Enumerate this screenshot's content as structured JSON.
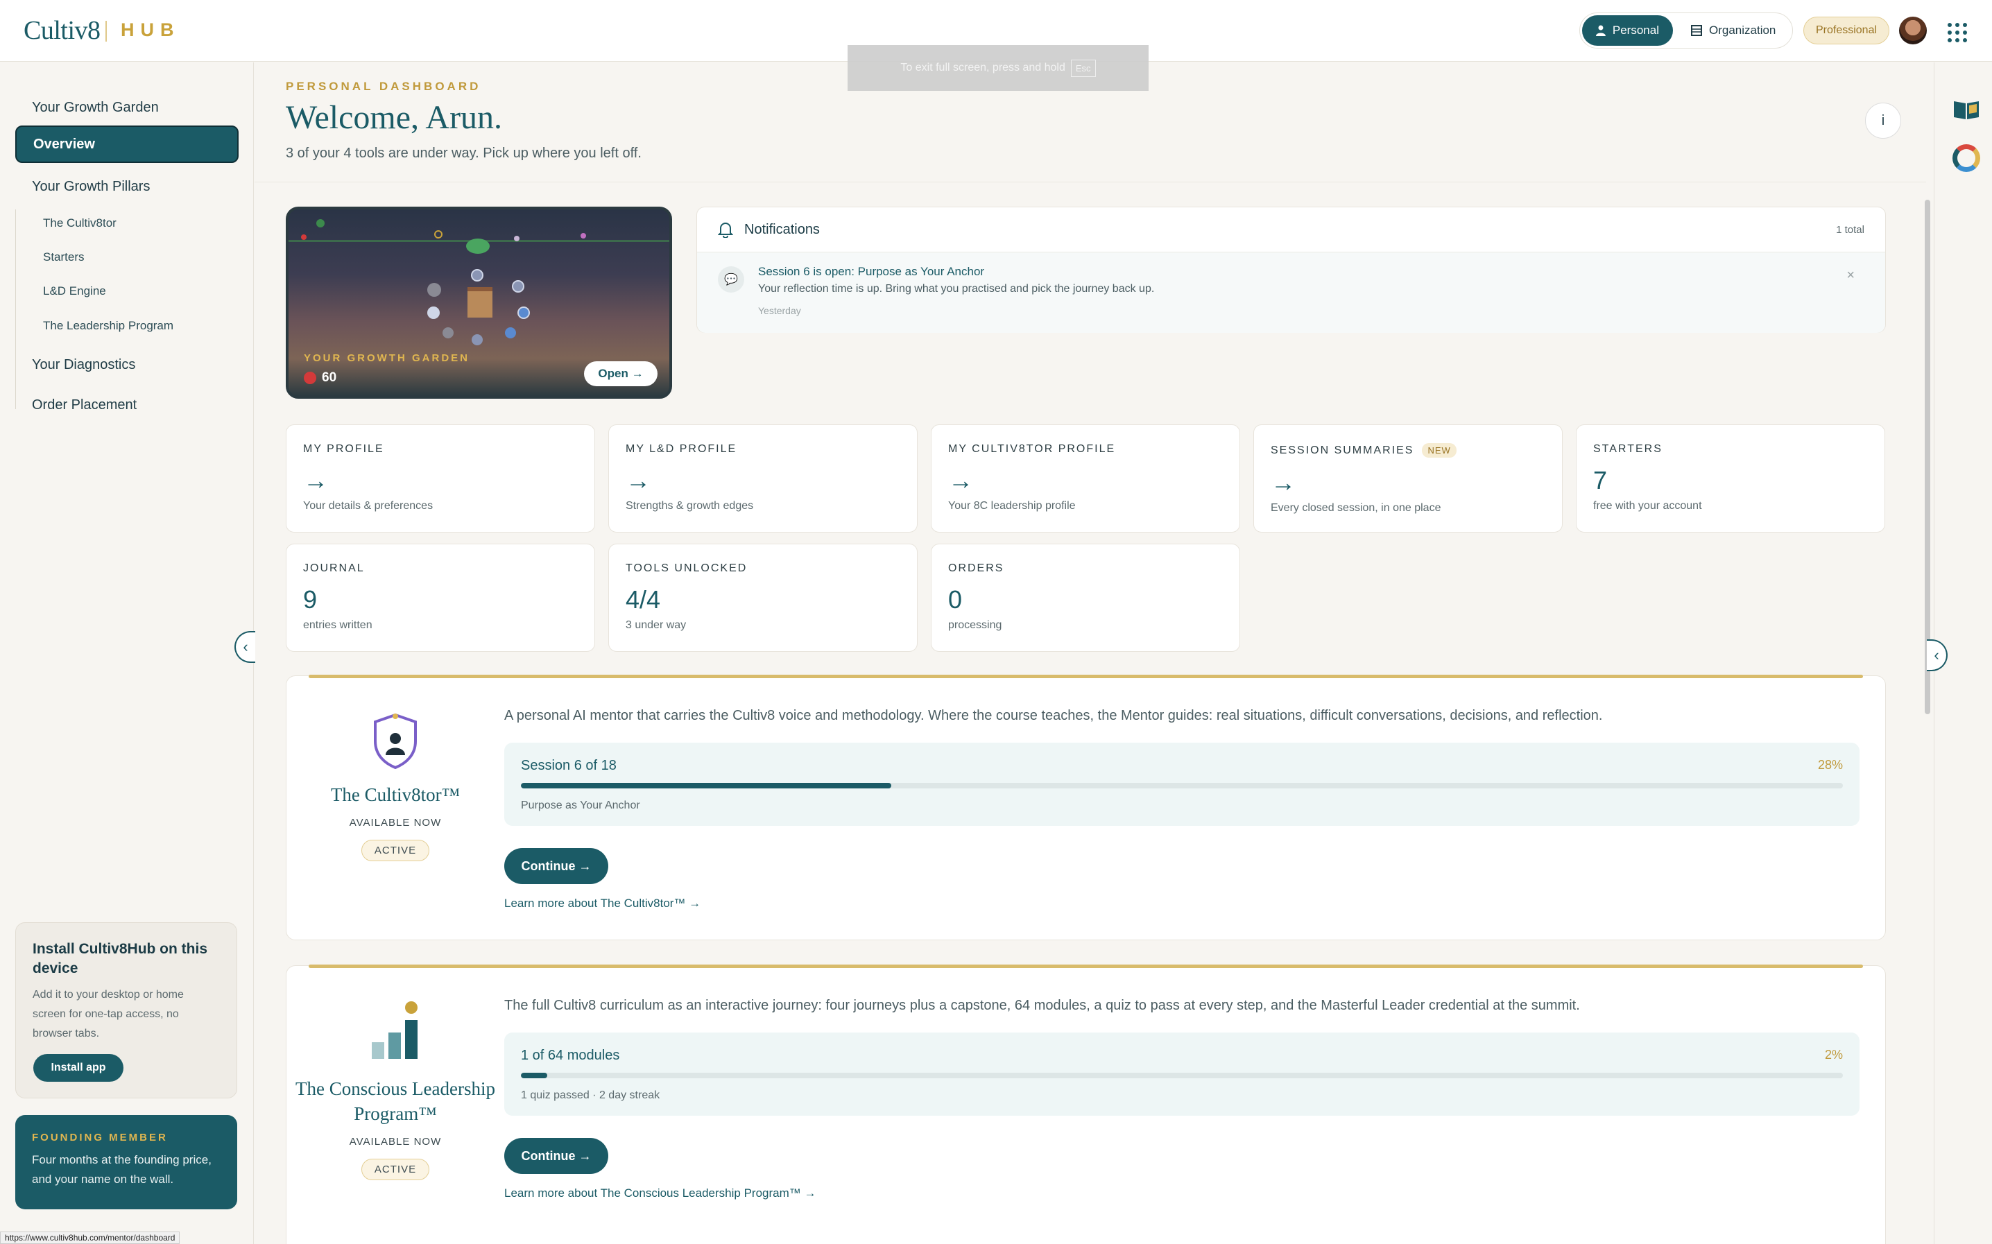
{
  "brand": {
    "name": "Cultiv8",
    "hub": "HUB"
  },
  "topbar": {
    "modes": [
      {
        "label": "Personal",
        "active": true,
        "icon": "person-icon"
      },
      {
        "label": "Organization",
        "active": false,
        "icon": "building-icon"
      }
    ],
    "plan_badge": "Professional",
    "avatar": "user-avatar",
    "apps_icon": "apps-grid-icon"
  },
  "fullscreen_toast": {
    "text": "To exit full screen, press and hold",
    "key": "Esc"
  },
  "sidebar": {
    "items": [
      {
        "label": "Your Growth Garden"
      },
      {
        "label": "Overview",
        "active": true
      },
      {
        "label": "Your Growth Pillars"
      },
      {
        "label": "Your Diagnostics"
      },
      {
        "label": "Order Placement"
      }
    ],
    "sub_items": [
      "The Cultiv8tor",
      "Starters",
      "L&D Engine",
      "The Leadership Program"
    ],
    "install_card": {
      "title": "Install Cultiv8Hub on this device",
      "desc": "Add it to your desktop or home screen for one-tap access, no browser tabs.",
      "button": "Install app"
    },
    "founding_card": {
      "title": "FOUNDING MEMBER",
      "desc": "Four months at the founding price, and your name on the wall."
    }
  },
  "status_url": "https://www.cultiv8hub.com/mentor/dashboard",
  "header": {
    "kicker": "PERSONAL DASHBOARD",
    "title": "Welcome, Arun.",
    "subtitle": "3 of your 4 tools are under way. Pick up where you left off.",
    "info_label": "i"
  },
  "garden": {
    "label": "YOUR GROWTH GARDEN",
    "count": "60",
    "open_label": "Open →"
  },
  "notifications": {
    "title": "Notifications",
    "total": "1 total",
    "items": [
      {
        "title": "Session 6 is open: Purpose as Your Anchor",
        "body": "Your reflection time is up. Bring what you practised and pick the journey back up.",
        "time": "Yesterday",
        "close": "×"
      }
    ]
  },
  "tiles": [
    {
      "label": "MY PROFILE",
      "value": "→",
      "sub": "Your details & preferences"
    },
    {
      "label": "MY L&D PROFILE",
      "value": "→",
      "sub": "Strengths & growth edges"
    },
    {
      "label": "MY CULTIV8TOR PROFILE",
      "value": "→",
      "sub": "Your 8C leadership profile"
    },
    {
      "label": "SESSION SUMMARIES",
      "badge": "NEW",
      "value": "→",
      "sub": "Every closed session, in one place"
    },
    {
      "label": "STARTERS",
      "value": "7",
      "sub": "free with your account"
    },
    {
      "label": "JOURNAL",
      "value": "9",
      "sub": "entries written"
    },
    {
      "label": "TOOLS UNLOCKED",
      "value": "4/4",
      "sub": "3 under way"
    },
    {
      "label": "ORDERS",
      "value": "0",
      "sub": "processing"
    }
  ],
  "tools": [
    {
      "name": "The Cultiv8tor™",
      "availability": "AVAILABLE NOW",
      "status": "ACTIVE",
      "description": "A personal AI mentor that carries the Cultiv8 voice and methodology. Where the course teaches, the Mentor guides: real situations, difficult conversations, decisions, and reflection.",
      "progress_title": "Session 6 of 18",
      "progress_pct": "28%",
      "progress_fraction": 0.28,
      "progress_note": "Purpose as Your Anchor",
      "cta": "Continue →",
      "learn_more": "Learn more about The Cultiv8tor™ →",
      "icon": "shield-person-icon"
    },
    {
      "name": "The Conscious Leadership Program™",
      "availability": "AVAILABLE NOW",
      "status": "ACTIVE",
      "description": "The full Cultiv8 curriculum as an interactive journey: four journeys plus a capstone, 64 modules, a quiz to pass at every step, and the Masterful Leader credential at the summit.",
      "progress_title": "1 of 64 modules",
      "progress_pct": "2%",
      "progress_fraction": 0.02,
      "progress_note": "1 quiz passed · 2 day streak",
      "cta": "Continue →",
      "learn_more": "Learn more about The Conscious Leadership Program™ →",
      "icon": "bar-chart-icon"
    }
  ],
  "colors": {
    "accent": "#1b5b66",
    "gold": "#c09a3c",
    "background": "#f7f5f1"
  }
}
